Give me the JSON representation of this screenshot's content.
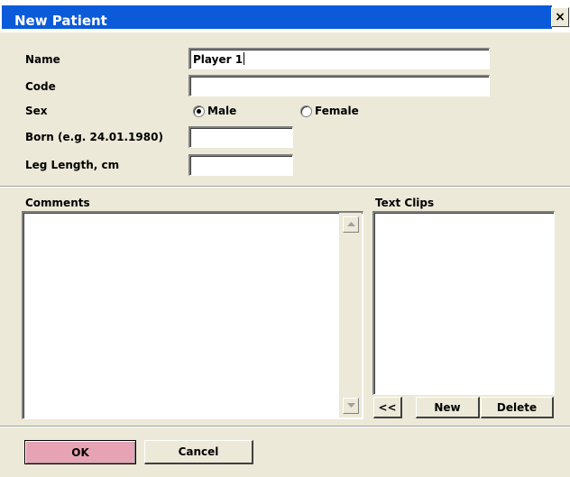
{
  "window": {
    "title": "New Patient",
    "close_glyph": "×"
  },
  "form": {
    "name_label": "Name",
    "name_value": "Player 1",
    "code_label": "Code",
    "code_value": "",
    "sex_label": "Sex",
    "sex_options": [
      {
        "label": "Male",
        "selected": true
      },
      {
        "label": "Female",
        "selected": false
      }
    ],
    "born_label": "Born (e.g. 24.01.1980)",
    "born_value": "",
    "leg_label": "Leg Length, cm",
    "leg_value": ""
  },
  "comments": {
    "label": "Comments",
    "value": ""
  },
  "text_clips": {
    "label": "Text Clips",
    "items": [],
    "buttons": {
      "back": "<<",
      "new": "New",
      "delete": "Delete"
    }
  },
  "footer": {
    "ok_label": "OK",
    "cancel_label": "Cancel"
  },
  "colors": {
    "titlebar": "#0a5ad9",
    "dialog_bg": "#ece9d8",
    "ok_button": "#e6a3b4"
  }
}
